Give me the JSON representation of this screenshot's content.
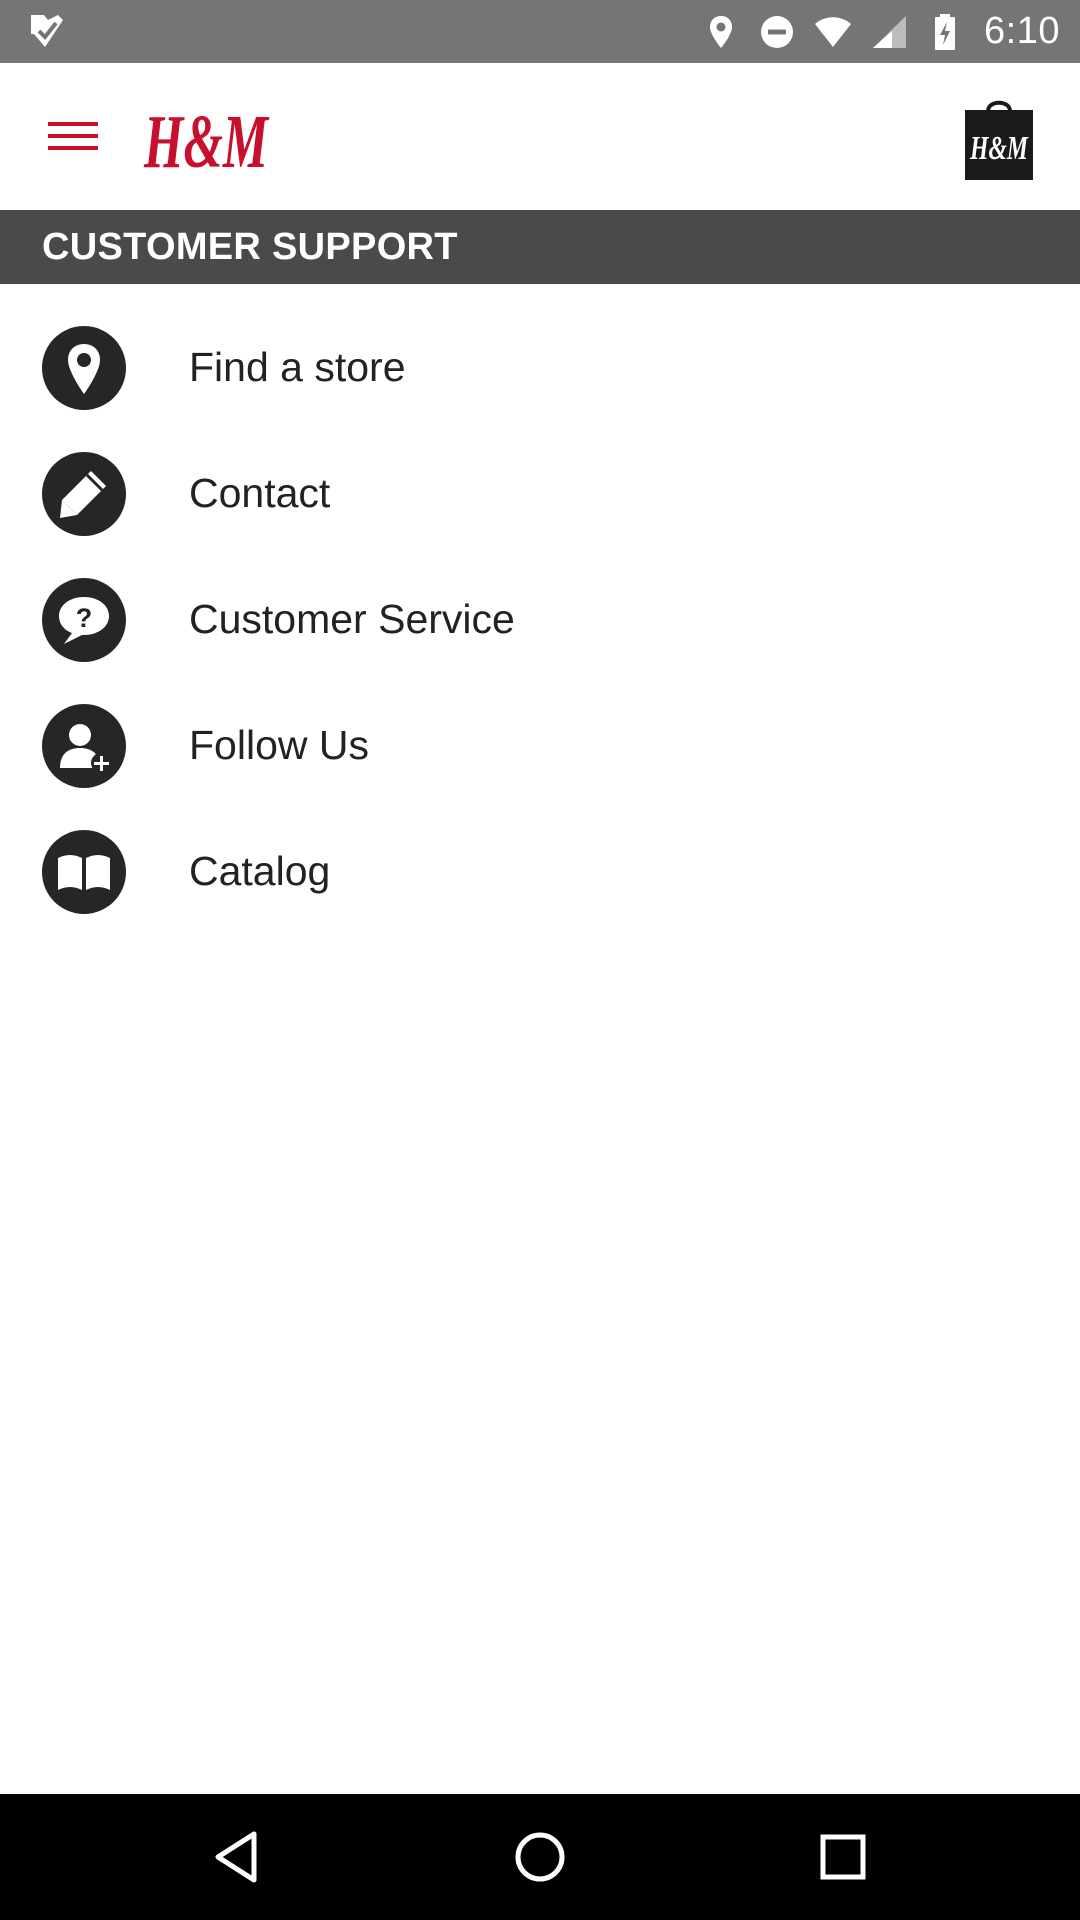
{
  "status_bar": {
    "time": "6:10",
    "left_icon": "task-check-icon",
    "icons": [
      "location-pin-icon",
      "do-not-disturb-icon",
      "wifi-icon",
      "cell-signal-icon",
      "battery-charging-icon"
    ]
  },
  "app_bar": {
    "menu_icon": "hamburger-menu-icon",
    "logo_text": "H&M",
    "bag_icon": "shopping-bag-icon",
    "bag_logo_text": "H&M",
    "brand_color": "#c8102e"
  },
  "section": {
    "title": "CUSTOMER SUPPORT"
  },
  "support_items": [
    {
      "label": "Find a store",
      "icon": "location-pin-icon"
    },
    {
      "label": "Contact",
      "icon": "pencil-icon"
    },
    {
      "label": "Customer Service",
      "icon": "question-bubble-icon"
    },
    {
      "label": "Follow Us",
      "icon": "add-person-icon"
    },
    {
      "label": "Catalog",
      "icon": "open-book-icon"
    }
  ],
  "nav_bar": {
    "icons": [
      "back-triangle-icon",
      "home-circle-icon",
      "recent-apps-square-icon"
    ]
  },
  "colors": {
    "status_bar_bg": "#757575",
    "section_header_bg": "#4a4a4a",
    "icon_circle": "#262626",
    "nav_bar_bg": "#000000"
  }
}
